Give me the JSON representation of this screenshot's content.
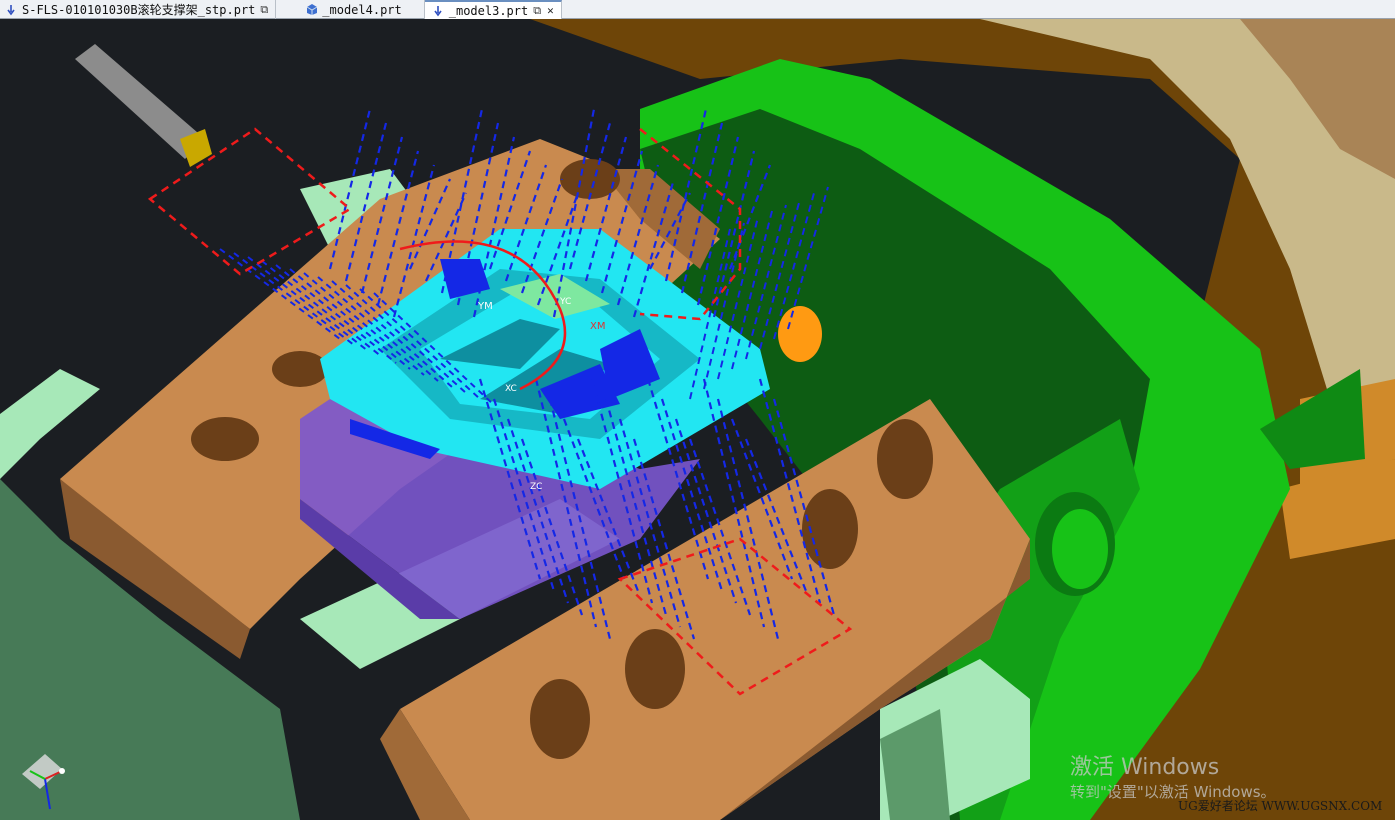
{
  "tabs": [
    {
      "label": "S-FLS-010101030B滚轮支撑架_stp.prt",
      "icon": "part-arrow-icon",
      "active": false
    },
    {
      "label": "_model4.prt",
      "icon": "part-model-icon",
      "active": false
    },
    {
      "label": "_model3.prt",
      "icon": "part-arrow-icon",
      "active": true
    }
  ],
  "tab_controls": {
    "restore_glyph": "⧉",
    "close_glyph": "✕"
  },
  "viewport": {
    "label_xm": "XM",
    "label_ym": "YM",
    "label_zc": "ZC",
    "label_yc": "YC",
    "label_xc": "XC"
  },
  "watermark": {
    "line1": "激活 Windows",
    "line2": "转到\"设置\"以激活 Windows。"
  },
  "forum_mark": "UG爱好者论坛 WWW.UGSNX.COM",
  "colors": {
    "background": "#1b1e22",
    "vise_body": "#c98a4f",
    "vise_dark": "#8a5a30",
    "fixture_green": "#17c217",
    "fixture_dark": "#0b7a12",
    "mint": "#a7e8b8",
    "workpiece_cyan": "#22e6f2",
    "stock_purple": "#7b57cf",
    "toolpath_blue": "#1428e6",
    "toolpath_red": "#ef1b1b",
    "chuck_beige": "#c9b98a"
  }
}
